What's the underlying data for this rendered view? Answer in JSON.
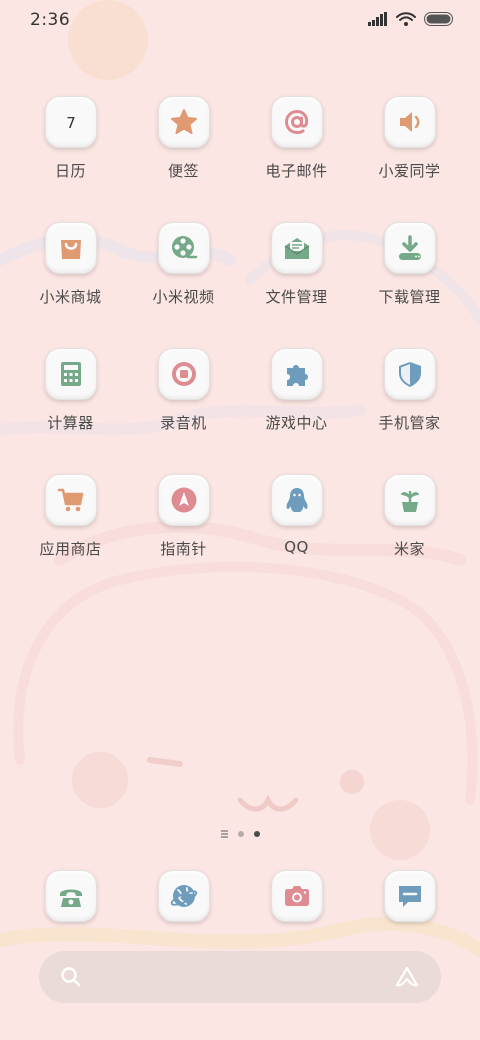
{
  "status_bar": {
    "time": "2:36",
    "signal_icon": "signal-icon",
    "wifi_icon": "wifi-icon",
    "battery_icon": "battery-icon"
  },
  "apps": [
    {
      "label": "日历",
      "icon": "calendar-icon",
      "icon_text": "7"
    },
    {
      "label": "便签",
      "icon": "star-icon"
    },
    {
      "label": "电子邮件",
      "icon": "at-sign-icon"
    },
    {
      "label": "小爱同学",
      "icon": "speaker-icon"
    },
    {
      "label": "小米商城",
      "icon": "shopping-bag-icon"
    },
    {
      "label": "小米视频",
      "icon": "film-reel-icon"
    },
    {
      "label": "文件管理",
      "icon": "envelope-icon"
    },
    {
      "label": "下载管理",
      "icon": "download-icon"
    },
    {
      "label": "计算器",
      "icon": "calculator-icon"
    },
    {
      "label": "录音机",
      "icon": "record-icon"
    },
    {
      "label": "游戏中心",
      "icon": "puzzle-icon"
    },
    {
      "label": "手机管家",
      "icon": "shield-icon"
    },
    {
      "label": "应用商店",
      "icon": "cart-icon"
    },
    {
      "label": "指南针",
      "icon": "compass-icon"
    },
    {
      "label": "QQ",
      "icon": "penguin-icon"
    },
    {
      "label": "米家",
      "icon": "plant-icon"
    }
  ],
  "page_indicator": {
    "pages": 3,
    "active_index": 2
  },
  "dock": [
    {
      "name": "phone",
      "icon": "phone-icon"
    },
    {
      "name": "browser",
      "icon": "browser-globe-icon"
    },
    {
      "name": "camera",
      "icon": "camera-icon"
    },
    {
      "name": "messages",
      "icon": "message-icon"
    }
  ],
  "search_bar": {
    "search_icon": "search-icon",
    "assistant_icon": "assistant-icon"
  },
  "colors": {
    "background": "#fbe6e3",
    "icon_orange": "#e09a72",
    "icon_pink": "#df8b92",
    "icon_green": "#76a989",
    "icon_blue": "#6e9cbc"
  }
}
